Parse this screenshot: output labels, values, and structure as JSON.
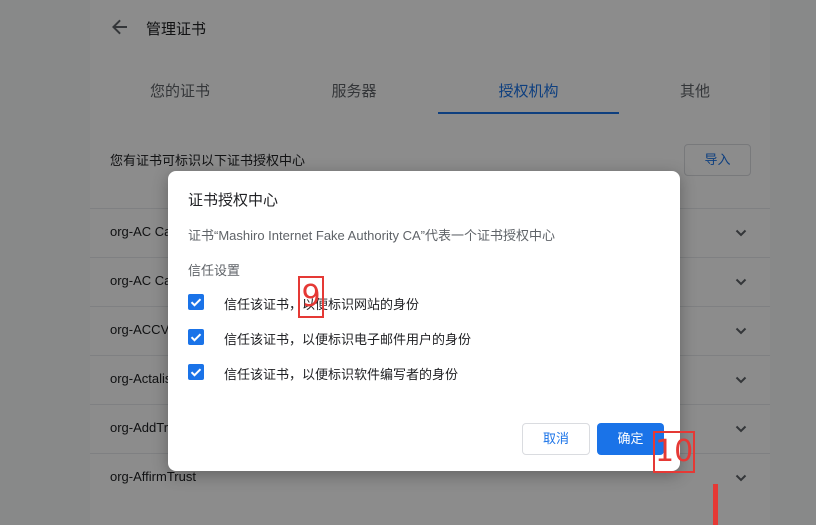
{
  "header": {
    "title": "管理证书"
  },
  "tabs": [
    {
      "label": "您的证书",
      "active": false
    },
    {
      "label": "服务器",
      "active": false
    },
    {
      "label": "授权机构",
      "active": true
    },
    {
      "label": "其他",
      "active": false
    }
  ],
  "description": "您有证书可标识以下证书授权中心",
  "import_label": "导入",
  "cert_rows": [
    "org-AC Camerfirma S.A.",
    "org-AC Camerfirma SA CIF A82743287",
    "org-ACCV",
    "org-Actalis S.p.A./03358520967",
    "org-AddTrust AB",
    "org-AffirmTrust"
  ],
  "dialog": {
    "title": "证书授权中心",
    "description": "证书“Mashiro Internet Fake Authority CA”代表一个证书授权中心",
    "section": "信任设置",
    "checkboxes": [
      {
        "label": "信任该证书，以便标识网站的身份",
        "checked": true
      },
      {
        "label": "信任该证书，以便标识电子邮件用户的身份",
        "checked": true
      },
      {
        "label": "信任该证书，以便标识软件编写者的身份",
        "checked": true
      }
    ],
    "cancel_label": "取消",
    "ok_label": "确定"
  },
  "markers": {
    "m9": "9",
    "m10": "10"
  },
  "colors": {
    "accent": "#1a73e8",
    "marker": "#e53935"
  }
}
